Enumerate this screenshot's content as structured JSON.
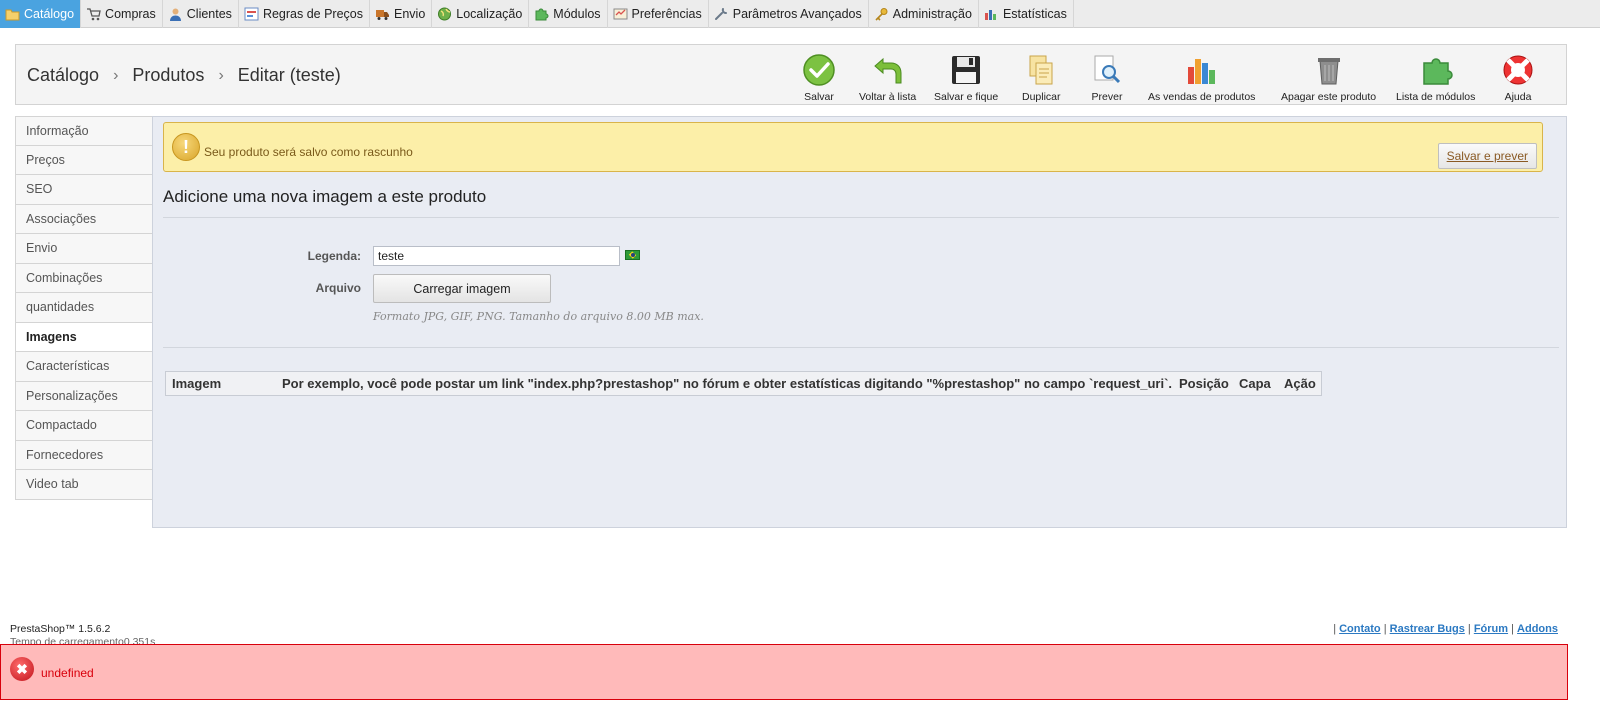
{
  "topnav": {
    "tabs": [
      {
        "label": "Catálogo",
        "icon": "folder-icon",
        "active": true
      },
      {
        "label": "Compras",
        "icon": "cart-icon"
      },
      {
        "label": "Clientes",
        "icon": "user-icon"
      },
      {
        "label": "Regras de Preços",
        "icon": "price-rules-icon"
      },
      {
        "label": "Envio",
        "icon": "truck-icon"
      },
      {
        "label": "Localização",
        "icon": "globe-icon"
      },
      {
        "label": "Módulos",
        "icon": "puzzle-icon"
      },
      {
        "label": "Preferências",
        "icon": "preferences-icon"
      },
      {
        "label": "Parâmetros Avançados",
        "icon": "wrench-icon"
      },
      {
        "label": "Administração",
        "icon": "key-icon"
      },
      {
        "label": "Estatísticas",
        "icon": "bar-chart-icon"
      }
    ]
  },
  "breadcrumb": {
    "items": [
      "Catálogo",
      "Produtos",
      "Editar (teste)"
    ],
    "separator": "›"
  },
  "toolbar": {
    "buttons": [
      {
        "label": "Salvar",
        "icon": "check-icon"
      },
      {
        "label": "Voltar à lista",
        "icon": "back-arrow-icon"
      },
      {
        "label": "Salvar e fique",
        "icon": "floppy-icon"
      },
      {
        "label": "Duplicar",
        "icon": "duplicate-icon"
      },
      {
        "label": "Prever",
        "icon": "preview-icon"
      },
      {
        "label": "As vendas de produtos",
        "icon": "sales-chart-icon"
      },
      {
        "label": "Apagar este produto",
        "icon": "trash-icon"
      },
      {
        "label": "Lista de módulos",
        "icon": "modules-icon"
      },
      {
        "label": "Ajuda",
        "icon": "lifebuoy-icon"
      }
    ]
  },
  "sidebar": {
    "items": [
      {
        "label": "Informação"
      },
      {
        "label": "Preços"
      },
      {
        "label": "SEO"
      },
      {
        "label": "Associações"
      },
      {
        "label": "Envio"
      },
      {
        "label": "Combinações"
      },
      {
        "label": "quantidades"
      },
      {
        "label": "Imagens",
        "active": true
      },
      {
        "label": "Características"
      },
      {
        "label": "Personalizações"
      },
      {
        "label": "Compactado"
      },
      {
        "label": "Fornecedores"
      },
      {
        "label": "Video tab"
      }
    ]
  },
  "warning": {
    "text": "Seu produto será salvo como rascunho",
    "button": "Salvar e prever",
    "icon": "exclamation-icon"
  },
  "form": {
    "title": "Adicione uma nova imagem a este produto",
    "caption_label": "Legenda:",
    "caption_value": "teste",
    "file_label": "Arquivo",
    "upload_button": "Carregar imagem",
    "hint": "Formato JPG, GIF, PNG. Tamanho do arquivo 8.00 MB max."
  },
  "image_table": {
    "headers": [
      "Imagem",
      "Por exemplo, você pode postar um link \"index.php?prestashop\" no fórum e obter estatísticas digitando \"%prestashop\" no campo `request_uri`.",
      "Posição",
      "Capa",
      "Ação"
    ]
  },
  "footer": {
    "version": "PrestaShop™ 1.5.6.2",
    "load_time": "Tempo de carregamento0.351s",
    "links": [
      "Contato",
      "Rastrear Bugs",
      "Fórum",
      "Addons"
    ]
  },
  "error": {
    "text": "undefined"
  },
  "colors": {
    "active_tab": "#4aa3e0",
    "warning_bg": "#fcefa8",
    "error_bg": "#ffbaba",
    "error_text": "#d8000c"
  }
}
